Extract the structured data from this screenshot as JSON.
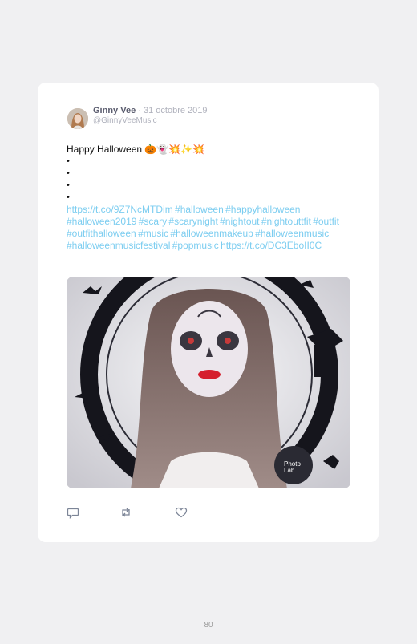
{
  "tweet": {
    "author_name": "Ginny Vee",
    "separator": "·",
    "date": "31 octobre 2019",
    "handle": "@GinnyVeeMusic",
    "lead_text": "Happy Halloween 🎃👻💥✨💥",
    "bullets": [
      "",
      "",
      "",
      ""
    ],
    "links_text": "https://t.co/9Z7NcMTDim #halloween #happyhalloween #halloween2019 #scary #scarynight #nightout #nightouttfit #outfit #outfithalloween #music #halloweenmakeup #halloweenmusic #halloweenmusicfestival #popmusic https://t.co/DC3EboII0C",
    "photo_watermark_line1": "Photo",
    "photo_watermark_line2": "Lab"
  },
  "actions": [
    {
      "icon": "reply-icon"
    },
    {
      "icon": "retweet-icon"
    },
    {
      "icon": "like-icon"
    }
  ],
  "page": {
    "number": "80"
  },
  "colors": {
    "link": "#7ccdf0",
    "name": "#5a5c6e",
    "meta": "#b0b2bd",
    "background": "#f0f0f2"
  }
}
